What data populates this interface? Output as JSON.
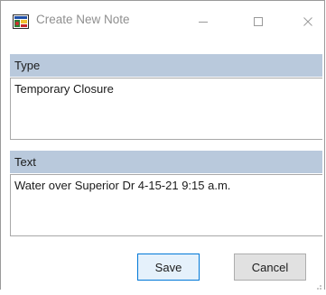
{
  "window": {
    "title": "Create New Note"
  },
  "type_section": {
    "label": "Type",
    "value": "Temporary Closure"
  },
  "text_section": {
    "label": "Text",
    "value": "Water over Superior Dr 4-15-21 9:15 a.m."
  },
  "buttons": {
    "save_label": "Save",
    "cancel_label": "Cancel"
  },
  "icons": {
    "app": "app-icon",
    "minimize": "minimize-icon",
    "maximize": "maximize-icon",
    "close": "close-icon",
    "resize": "resize-grip-icon"
  }
}
